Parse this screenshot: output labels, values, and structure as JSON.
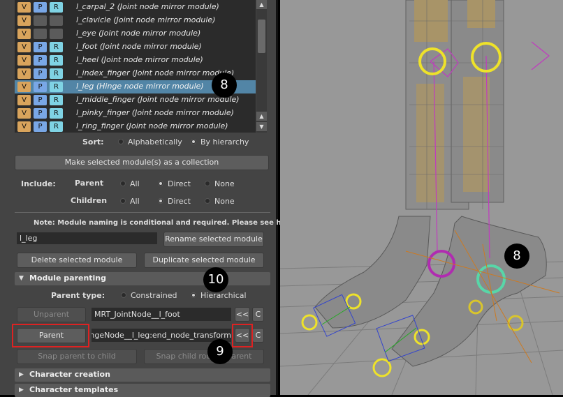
{
  "module_list": {
    "items": [
      {
        "v": "V",
        "p": "P",
        "r": "R",
        "label": "l_carpal_2 (Joint node mirror module)",
        "pr_active": true,
        "selected": false
      },
      {
        "v": "V",
        "p": "",
        "r": "",
        "label": "l_clavicle (Joint node mirror module)",
        "pr_active": false,
        "selected": false
      },
      {
        "v": "V",
        "p": "",
        "r": "",
        "label": "l_eye (Joint node mirror module)",
        "pr_active": false,
        "selected": false
      },
      {
        "v": "V",
        "p": "P",
        "r": "R",
        "label": "l_foot (Joint node mirror module)",
        "pr_active": true,
        "selected": false
      },
      {
        "v": "V",
        "p": "P",
        "r": "R",
        "label": "l_heel (Joint node mirror module)",
        "pr_active": true,
        "selected": false
      },
      {
        "v": "V",
        "p": "P",
        "r": "R",
        "label": "l_index_finger (Joint node mirror module)",
        "pr_active": true,
        "selected": false
      },
      {
        "v": "V",
        "p": "P",
        "r": "R",
        "label": "l_leg (Hinge node mirror module)",
        "pr_active": true,
        "selected": true
      },
      {
        "v": "V",
        "p": "P",
        "r": "R",
        "label": "l_middle_finger (Joint node mirror module)",
        "pr_active": true,
        "selected": false
      },
      {
        "v": "V",
        "p": "P",
        "r": "R",
        "label": "l_pinky_finger (Joint node mirror module)",
        "pr_active": true,
        "selected": false
      },
      {
        "v": "V",
        "p": "P",
        "r": "R",
        "label": "l_ring_finger (Joint node mirror module)",
        "pr_active": true,
        "selected": false
      }
    ]
  },
  "sort": {
    "label": "Sort:",
    "option1": "Alphabetically",
    "option2": "By hierarchy",
    "selected": "By hierarchy"
  },
  "collection_button": "Make selected module(s) as a collection",
  "include": {
    "label": "Include:",
    "parent_label": "Parent",
    "children_label": "Children",
    "opt_all": "All",
    "opt_direct": "Direct",
    "opt_none": "None",
    "parent_selected": "Direct",
    "children_selected": "Direct"
  },
  "note": "Note: Module naming is conditional and required. Please see help.",
  "name_field": "l_leg",
  "rename_button": "Rename selected module",
  "delete_button": "Delete selected module",
  "duplicate_button": "Duplicate selected module",
  "module_parenting": {
    "header": "Module parenting",
    "parent_type_label": "Parent type:",
    "opt_constrained": "Constrained",
    "opt_hierarchical": "Hierarchical",
    "selected": "Hierarchical",
    "unparent_button": "Unparent",
    "current_parent": "MRT_JointNode__l_foot",
    "parent_button": "Parent",
    "new_parent": "MRT_HingeNode__l_leg:end_node_transform",
    "arrow_label": "<<",
    "c_label": "C",
    "snap_parent_button": "Snap parent to child",
    "snap_child_button": "Snap child root to parent"
  },
  "collapsed_sections": [
    "Character creation",
    "Character templates"
  ],
  "callouts": [
    "8",
    "10",
    "9",
    "8"
  ],
  "colors": {
    "panel": "#444444",
    "list_bg": "#2b2b2b",
    "selection": "#5285a6",
    "viewport": "#989898",
    "highlight_box": "#dd2222"
  }
}
